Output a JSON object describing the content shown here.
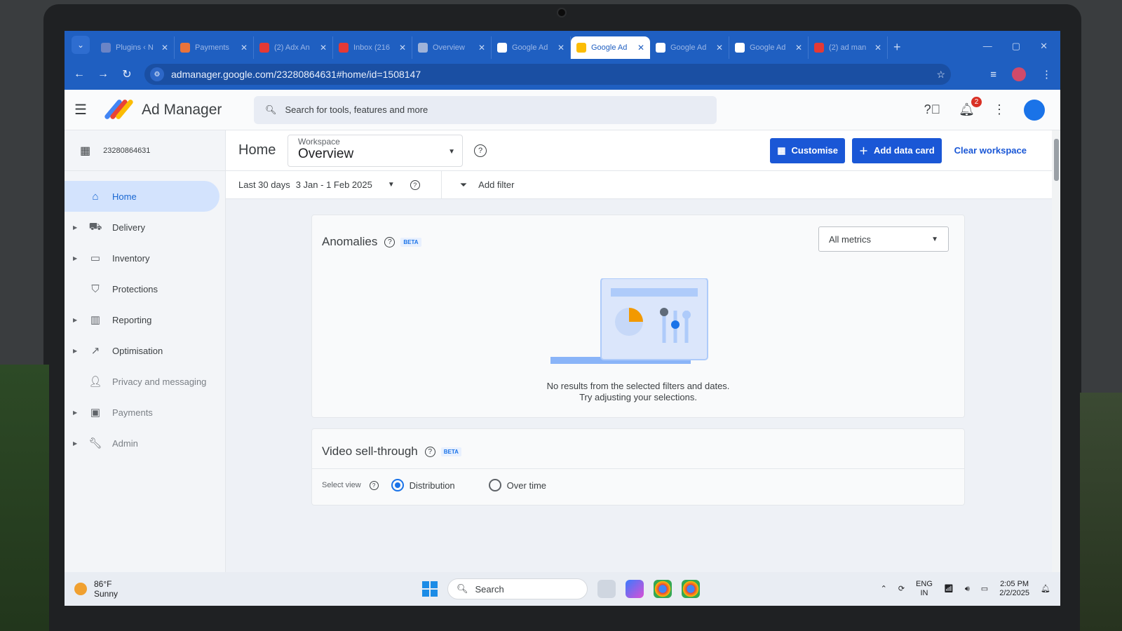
{
  "browser": {
    "tabs": [
      {
        "title": "Plugins ‹ N",
        "fav_color": "#6b84c6"
      },
      {
        "title": "Payments",
        "fav_color": "#e8733b"
      },
      {
        "title": "(2) Adx An",
        "fav_color": "#e53935"
      },
      {
        "title": "Inbox (216",
        "fav_color": "#e53935"
      },
      {
        "title": "Overview",
        "fav_color": "#9fb3d9"
      },
      {
        "title": "Google Ad",
        "fav_color": "#ffffff"
      },
      {
        "title": "Google Ad",
        "fav_color": "#fbbc04",
        "active": true
      },
      {
        "title": "Google Ad",
        "fav_color": "#ffffff"
      },
      {
        "title": "Google Ad",
        "fav_color": "#ffffff"
      },
      {
        "title": "(2) ad man",
        "fav_color": "#e53935"
      }
    ],
    "url": "admanager.google.com/23280864631#home/id=1508147"
  },
  "app": {
    "name": "Ad Manager",
    "search_placeholder": "Search for tools, features and more",
    "notification_count": "2"
  },
  "sidebar": {
    "network_id": "23280864631",
    "items": [
      {
        "label": "Home",
        "icon": "home-icon",
        "active": true,
        "caret": false
      },
      {
        "label": "Delivery",
        "icon": "truck-icon",
        "caret": true
      },
      {
        "label": "Inventory",
        "icon": "inventory-icon",
        "caret": true
      },
      {
        "label": "Protections",
        "icon": "shield-icon",
        "caret": false
      },
      {
        "label": "Reporting",
        "icon": "bar-chart-icon",
        "caret": true
      },
      {
        "label": "Optimisation",
        "icon": "trend-icon",
        "caret": true
      },
      {
        "label": "Privacy and messaging",
        "icon": "person-icon",
        "caret": false
      },
      {
        "label": "Payments",
        "icon": "payments-icon",
        "caret": true
      },
      {
        "label": "Admin",
        "icon": "wrench-icon",
        "caret": true
      }
    ]
  },
  "topbar": {
    "page_title": "Home",
    "workspace_label": "Workspace",
    "workspace_value": "Overview",
    "customise_label": "Customise",
    "add_data_card_label": "Add data card",
    "clear_workspace_label": "Clear workspace"
  },
  "filters": {
    "range_label": "Last 30 days",
    "range_value": "3 Jan - 1 Feb 2025",
    "add_filter_label": "Add filter"
  },
  "anomalies_card": {
    "title": "Anomalies",
    "badge": "BETA",
    "metrics_select": "All metrics",
    "empty_line1": "No results from the selected filters and dates.",
    "empty_line2": "Try adjusting your selections."
  },
  "video_card": {
    "title": "Video sell-through",
    "badge": "BETA",
    "select_view_label": "Select view",
    "options": [
      "Distribution",
      "Over time"
    ],
    "selected": "Distribution"
  },
  "taskbar": {
    "temperature": "86°F",
    "weather": "Sunny",
    "search_label": "Search",
    "lang1": "ENG",
    "lang2": "IN",
    "time": "2:05 PM",
    "date": "2/2/2025"
  },
  "colors": {
    "accent": "#1a57d6",
    "active_nav_bg": "#d3e3fd",
    "browser_frame": "#1f5fc1"
  }
}
